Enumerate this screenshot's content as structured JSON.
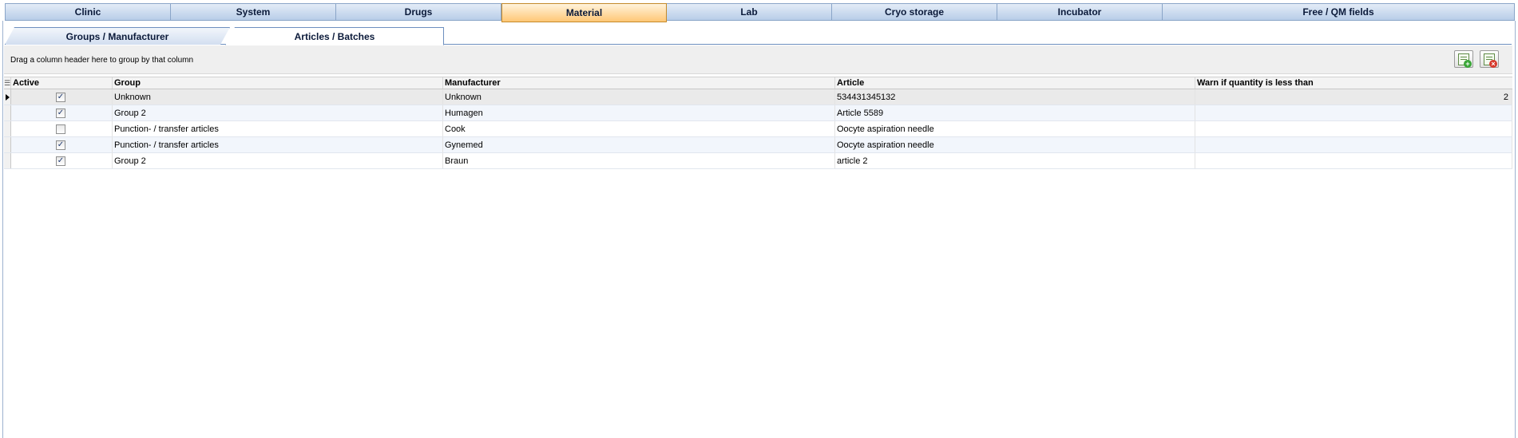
{
  "top_tabs": [
    {
      "label": "Clinic",
      "active": false
    },
    {
      "label": "System",
      "active": false
    },
    {
      "label": "Drugs",
      "active": false
    },
    {
      "label": "Material",
      "active": true
    },
    {
      "label": "Lab",
      "active": false
    },
    {
      "label": "Cryo storage",
      "active": false
    },
    {
      "label": "Incubator",
      "active": false
    },
    {
      "label": "Free / QM fields",
      "active": false
    }
  ],
  "sub_tabs": {
    "groups_manufacturer": "Groups / Manufacturer",
    "articles_batches": "Articles / Batches",
    "active": "articles_batches"
  },
  "group_panel": {
    "hint": "Drag a column header here to group by that column",
    "add_icon": "add-document-icon",
    "delete_icon": "delete-document-icon"
  },
  "grid": {
    "columns": {
      "active": "Active",
      "group": "Group",
      "manufacturer": "Manufacturer",
      "article": "Article",
      "warn": "Warn if quantity is less than"
    },
    "rows": [
      {
        "active": true,
        "group": "Unknown",
        "manufacturer": "Unknown",
        "article": "534431345132",
        "warn": "2",
        "current": true
      },
      {
        "active": true,
        "group": "Group 2",
        "manufacturer": "Humagen",
        "article": "Article 5589",
        "warn": "",
        "current": false
      },
      {
        "active": false,
        "group": "Punction- / transfer articles",
        "manufacturer": "Cook",
        "article": "Oocyte aspiration needle",
        "warn": "",
        "current": false
      },
      {
        "active": true,
        "group": "Punction- / transfer articles",
        "manufacturer": "Gynemed",
        "article": "Oocyte aspiration needle",
        "warn": "",
        "current": false
      },
      {
        "active": true,
        "group": "Group 2",
        "manufacturer": "Braun",
        "article": "article 2",
        "warn": "",
        "current": false
      }
    ]
  },
  "colors": {
    "active_tab": "#ffc776",
    "tab_bar": "#b8cde8",
    "alt_row": "#f2f6fc",
    "current_row": "#eaeaea"
  }
}
